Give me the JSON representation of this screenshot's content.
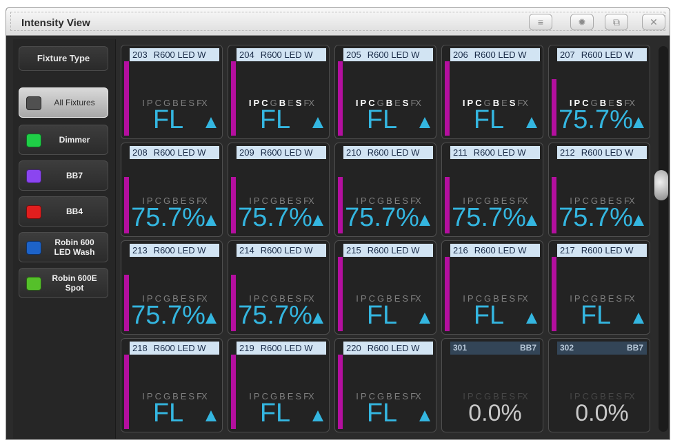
{
  "window": {
    "title": "Intensity View"
  },
  "toolbar_icons": [
    "menu-icon",
    "gear-icon",
    "maximize-icon",
    "close-icon"
  ],
  "toolbar_glyphs": {
    "menu": "≡",
    "gear": "✹",
    "maximize": "⧉",
    "close": "✕"
  },
  "sidebar": {
    "header": "Fixture Type",
    "items": [
      {
        "label": "All Fixtures",
        "color": "#505050",
        "selected": true
      },
      {
        "label": "Dimmer",
        "color": "#1fcf47",
        "selected": false
      },
      {
        "label": "BB7",
        "color": "#8b45f0",
        "selected": false
      },
      {
        "label": "BB4",
        "color": "#e01e1e",
        "selected": false
      },
      {
        "label": "Robin 600\nLED Wash",
        "color": "#1d63c9",
        "selected": false
      },
      {
        "label": "Robin 600E\nSpot",
        "color": "#55c02a",
        "selected": false
      }
    ]
  },
  "attribute_letters": [
    "I",
    "P",
    "C",
    "G",
    "B",
    "E",
    "S",
    "FX"
  ],
  "fixtures": [
    {
      "number": "203",
      "type": "R600 LED W",
      "value": "FL",
      "level": 1.0,
      "active_attrs": [],
      "arrow": true,
      "dim": false
    },
    {
      "number": "204",
      "type": "R600 LED W",
      "value": "FL",
      "level": 1.0,
      "active_attrs": [
        "I",
        "P",
        "C",
        "B",
        "S"
      ],
      "arrow": true,
      "dim": false
    },
    {
      "number": "205",
      "type": "R600 LED W",
      "value": "FL",
      "level": 1.0,
      "active_attrs": [
        "I",
        "P",
        "C",
        "B",
        "S"
      ],
      "arrow": true,
      "dim": false
    },
    {
      "number": "206",
      "type": "R600 LED W",
      "value": "FL",
      "level": 1.0,
      "active_attrs": [
        "I",
        "P",
        "C",
        "B",
        "S"
      ],
      "arrow": true,
      "dim": false
    },
    {
      "number": "207",
      "type": "R600 LED W",
      "value": "75.7%",
      "level": 0.757,
      "active_attrs": [
        "I",
        "P",
        "C",
        "B",
        "S"
      ],
      "arrow": true,
      "dim": false
    },
    {
      "number": "208",
      "type": "R600 LED W",
      "value": "75.7%",
      "level": 0.757,
      "active_attrs": [],
      "arrow": true,
      "dim": false
    },
    {
      "number": "209",
      "type": "R600 LED W",
      "value": "75.7%",
      "level": 0.757,
      "active_attrs": [],
      "arrow": true,
      "dim": false
    },
    {
      "number": "210",
      "type": "R600 LED W",
      "value": "75.7%",
      "level": 0.757,
      "active_attrs": [],
      "arrow": true,
      "dim": false
    },
    {
      "number": "211",
      "type": "R600 LED W",
      "value": "75.7%",
      "level": 0.757,
      "active_attrs": [],
      "arrow": true,
      "dim": false
    },
    {
      "number": "212",
      "type": "R600 LED W",
      "value": "75.7%",
      "level": 0.757,
      "active_attrs": [],
      "arrow": true,
      "dim": false
    },
    {
      "number": "213",
      "type": "R600 LED W",
      "value": "75.7%",
      "level": 0.757,
      "active_attrs": [],
      "arrow": true,
      "dim": false
    },
    {
      "number": "214",
      "type": "R600 LED W",
      "value": "75.7%",
      "level": 0.757,
      "active_attrs": [],
      "arrow": true,
      "dim": false
    },
    {
      "number": "215",
      "type": "R600 LED W",
      "value": "FL",
      "level": 1.0,
      "active_attrs": [],
      "arrow": true,
      "dim": false
    },
    {
      "number": "216",
      "type": "R600 LED W",
      "value": "FL",
      "level": 1.0,
      "active_attrs": [],
      "arrow": true,
      "dim": false
    },
    {
      "number": "217",
      "type": "R600 LED W",
      "value": "FL",
      "level": 1.0,
      "active_attrs": [],
      "arrow": true,
      "dim": false
    },
    {
      "number": "218",
      "type": "R600 LED W",
      "value": "FL",
      "level": 1.0,
      "active_attrs": [],
      "arrow": true,
      "dim": false
    },
    {
      "number": "219",
      "type": "R600 LED W",
      "value": "FL",
      "level": 1.0,
      "active_attrs": [],
      "arrow": true,
      "dim": false
    },
    {
      "number": "220",
      "type": "R600 LED W",
      "value": "FL",
      "level": 1.0,
      "active_attrs": [],
      "arrow": true,
      "dim": false
    },
    {
      "number": "301",
      "type": "BB7",
      "value": "0.0%",
      "level": 0.0,
      "active_attrs": [],
      "arrow": false,
      "dim": true
    },
    {
      "number": "302",
      "type": "BB7",
      "value": "0.0%",
      "level": 0.0,
      "active_attrs": [],
      "arrow": false,
      "dim": true
    }
  ]
}
